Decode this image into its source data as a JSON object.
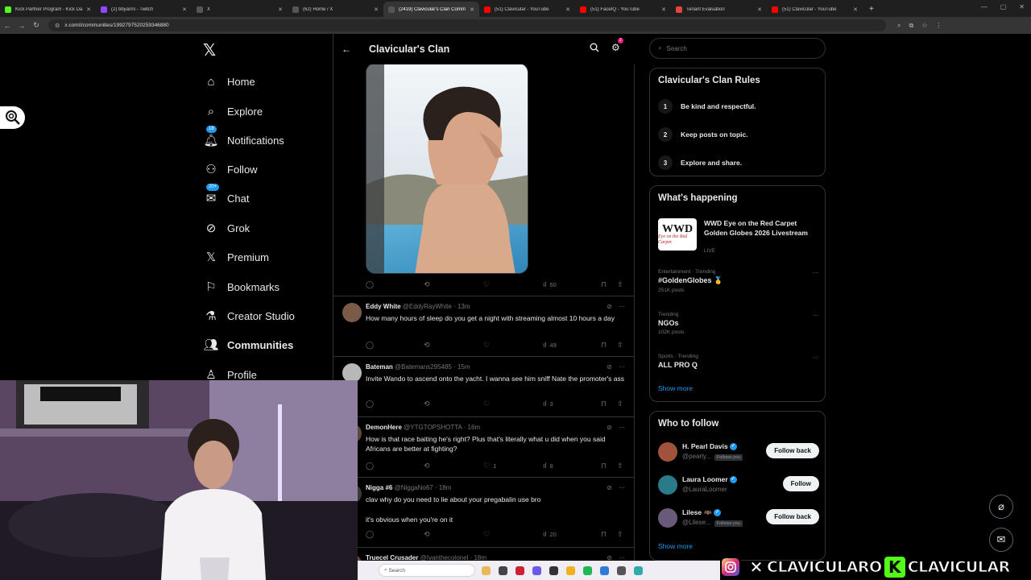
{
  "browser": {
    "tabs": [
      {
        "label": "Kick Partner Program - Kick Da",
        "color": "#53fc18"
      },
      {
        "label": "(2) bbyanni - Twitch",
        "color": "#9146ff"
      },
      {
        "label": "X",
        "color": "#555555"
      },
      {
        "label": "(62) Home / X",
        "color": "#555555"
      },
      {
        "label": "(2419) Clavicular's Clan Comm",
        "color": "#555555"
      },
      {
        "label": "(51) Clavicular - YouTube",
        "color": "#ff0000"
      },
      {
        "label": "(51) FaceIQ - YouTube",
        "color": "#ff0000"
      },
      {
        "label": "Tenant Evaluation",
        "color": "#e0463f"
      },
      {
        "label": "(51) Clavicular - YouTube",
        "color": "#ff0000"
      }
    ],
    "url": "x.com/i/communities/1992797520259346880"
  },
  "nav": {
    "items": [
      {
        "label": "Home",
        "icon": "home-icon"
      },
      {
        "label": "Explore",
        "icon": "search-icon"
      },
      {
        "label": "Notifications",
        "icon": "bell-icon",
        "badge": "18"
      },
      {
        "label": "Follow",
        "icon": "follow-icon"
      },
      {
        "label": "Chat",
        "icon": "mail-icon",
        "badge": "20+"
      },
      {
        "label": "Grok",
        "icon": "grok-icon"
      },
      {
        "label": "Premium",
        "icon": "x-icon"
      },
      {
        "label": "Bookmarks",
        "icon": "bookmark-icon"
      },
      {
        "label": "Creator Studio",
        "icon": "flask-icon"
      },
      {
        "label": "Communities",
        "icon": "communities-icon"
      },
      {
        "label": "Profile",
        "icon": "profile-icon"
      }
    ]
  },
  "header": {
    "title": "Clavicular's Clan",
    "gear_badge": "2"
  },
  "first_post": {
    "views": "60"
  },
  "tweets": [
    {
      "name": "Eddy White",
      "handle": "@EddyRayWhite",
      "time": "· 13m",
      "text": "How many hours of sleep do you get a night with streaming almost 10 hours a day",
      "likes": "",
      "views": "49",
      "avatar": "#7a5a48"
    },
    {
      "name": "Bateman",
      "handle": "@Batemans295485",
      "time": "· 15m",
      "text": "Invite Wando to ascend onto the yacht. I wanna see him sniff Nate the promoter's ass",
      "likes": "",
      "views": "3",
      "avatar": "#b8b8b8"
    },
    {
      "name": "DemonHere",
      "handle": "@YTGTOPSHOTTA",
      "time": "· 16m",
      "text": "How is that race baiting he's right? Plus that's literally what u did when you said Africans are better at fighting?",
      "likes": "1",
      "views": "8",
      "avatar": "#5a4a3a"
    },
    {
      "name": "Nigga #6",
      "handle": "@NiggaNo67",
      "time": "· 18m",
      "text": "clav why do you need to lie about your pregabalin use bro",
      "text2": "it's obvious when you're on it",
      "likes": "",
      "views": "20",
      "avatar": "#3a3a3a"
    },
    {
      "name": "Truecel Crusader",
      "handle": "@Ivanthecolonel",
      "time": "· 18m",
      "text": "",
      "avatar": "#6a4a3a"
    }
  ],
  "right": {
    "search_placeholder": "Search",
    "rules_title": "Clavicular's Clan Rules",
    "rules": [
      {
        "num": "1",
        "text": "Be kind and respectful."
      },
      {
        "num": "2",
        "text": "Keep posts on topic."
      },
      {
        "num": "3",
        "text": "Explore and share."
      }
    ],
    "happening_title": "What's happening",
    "featured": {
      "thumb1": "WWD",
      "thumb2": "Eye on the Red Carpet",
      "title": "WWD Eye on the Red Carpet Golden Globes 2026 Livestream",
      "status": "LIVE"
    },
    "trends": [
      {
        "category": "Entertainment · Trending",
        "title": "#GoldenGlobes 🥇",
        "count": "251K posts"
      },
      {
        "category": "Trending",
        "title": "NGOs",
        "count": "102K posts"
      },
      {
        "category": "Sports · Trending",
        "title": "ALL PRO Q",
        "count": ""
      }
    ],
    "show_more": "Show more",
    "who_title": "Who to follow",
    "follows": [
      {
        "name": "H. Pearl Davis",
        "handle": "@pearly...",
        "tag": "Follows you",
        "button": "Follow back",
        "avatar": "#a0523a"
      },
      {
        "name": "Laura Loomer",
        "handle": "@LauraLoomer",
        "tag": "",
        "button": "Follow",
        "avatar": "#2a7a8a"
      },
      {
        "name": "Lilese 🦇",
        "handle": "@Lilese...",
        "tag": "Follows you",
        "button": "Follow back",
        "avatar": "#6a5a7a"
      }
    ],
    "show_more2": "Show more"
  },
  "taskbar": {
    "search": "Search"
  },
  "banner": {
    "text1": "CLAVICULARO",
    "text2": "CLAVICULAR"
  }
}
